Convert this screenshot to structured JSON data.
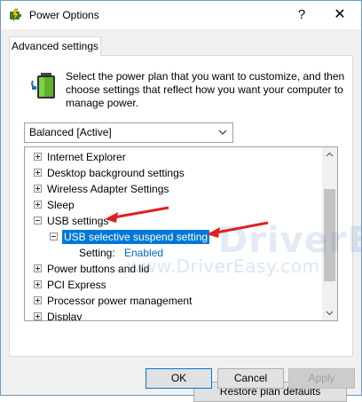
{
  "window": {
    "title": "Power Options",
    "help_glyph": "?",
    "close_glyph": "✕"
  },
  "tabs": [
    {
      "label": "Advanced settings",
      "active": true
    }
  ],
  "description": "Select the power plan that you want to customize, and then choose settings that reflect how you want your computer to manage power.",
  "plan_select": {
    "value": "Balanced [Active]"
  },
  "tree": {
    "items": [
      {
        "label": "Internet Explorer",
        "expanded": false
      },
      {
        "label": "Desktop background settings",
        "expanded": false
      },
      {
        "label": "Wireless Adapter Settings",
        "expanded": false
      },
      {
        "label": "Sleep",
        "expanded": false
      },
      {
        "label": "USB settings",
        "expanded": true
      },
      {
        "label": "USB selective suspend setting",
        "expanded": true,
        "selected": true,
        "level": 1
      },
      {
        "setting_label": "Setting:",
        "setting_value": "Enabled",
        "level": 2
      },
      {
        "label": "Power buttons and lid",
        "expanded": false
      },
      {
        "label": "PCI Express",
        "expanded": false
      },
      {
        "label": "Processor power management",
        "expanded": false
      },
      {
        "label": "Display",
        "expanded": false
      }
    ]
  },
  "watermark": {
    "logo": "DriverEasy",
    "url": "www.DriverEasy.com"
  },
  "buttons": {
    "restore": "Restore plan defaults",
    "ok": "OK",
    "cancel": "Cancel",
    "apply": "Apply"
  },
  "colors": {
    "selection": "#0078d7",
    "annotation_arrow": "#e02020",
    "link": "#0066cc"
  }
}
